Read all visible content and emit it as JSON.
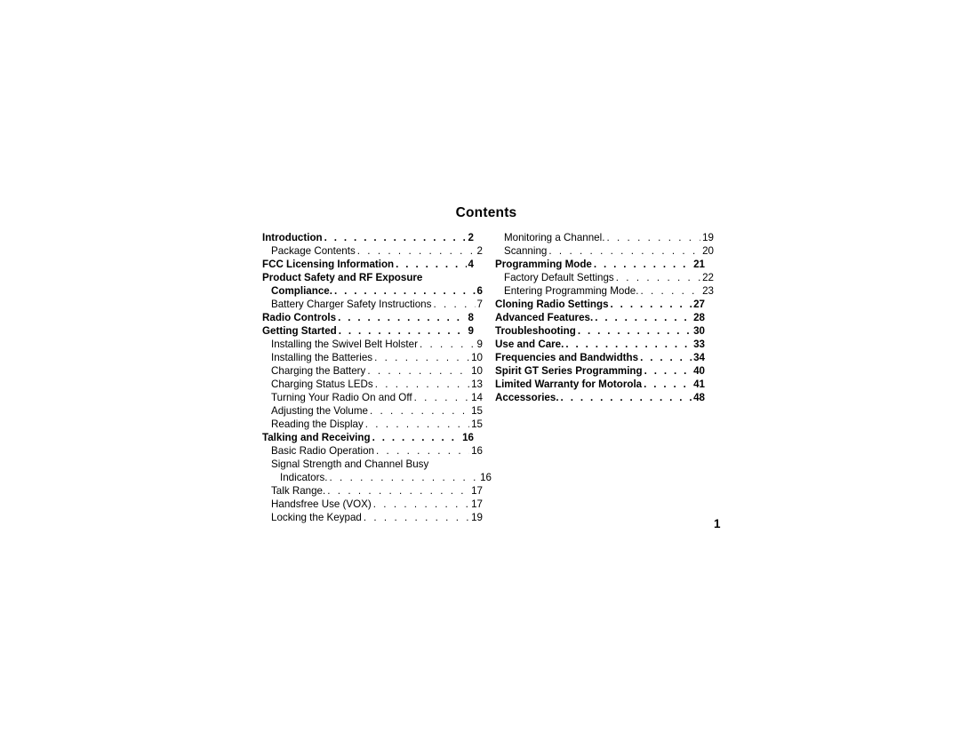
{
  "page": {
    "title": "Contents",
    "folio": "1",
    "background_color": "#ffffff",
    "text_color": "#000000"
  },
  "toc": {
    "leader_dots": ". . . . . . . . . . . . . . . . . . . . . . . . . . . . . . . . . . . . . . . . . . . . . . . . . . . . . . .",
    "left_column": [
      {
        "label": "Introduction",
        "page": "2",
        "level": "chapter",
        "leader": true
      },
      {
        "label": "Package Contents",
        "page": "2",
        "level": "sub",
        "leader": true
      },
      {
        "label": "FCC Licensing Information",
        "page": "4",
        "level": "chapter",
        "leader": true
      },
      {
        "label": "Product Safety and RF Exposure",
        "page": "",
        "level": "chapter",
        "leader": false
      },
      {
        "label": "Compliance.",
        "page": "6",
        "level": "chapter-cont",
        "leader": true
      },
      {
        "label": "Battery Charger Safety Instructions",
        "page": "7",
        "level": "sub",
        "leader": true
      },
      {
        "label": "Radio Controls",
        "page": "8",
        "level": "chapter",
        "leader": true
      },
      {
        "label": "Getting Started",
        "page": "9",
        "level": "chapter",
        "leader": true
      },
      {
        "label": "Installing the Swivel Belt Holster",
        "page": "9",
        "level": "sub",
        "leader": true
      },
      {
        "label": "Installing the Batteries",
        "page": "10",
        "level": "sub",
        "leader": true
      },
      {
        "label": "Charging the Battery",
        "page": "10",
        "level": "sub",
        "leader": true
      },
      {
        "label": "Charging Status LEDs",
        "page": "13",
        "level": "sub",
        "leader": true
      },
      {
        "label": "Turning Your Radio On and Off",
        "page": "14",
        "level": "sub",
        "leader": true
      },
      {
        "label": "Adjusting the Volume",
        "page": "15",
        "level": "sub",
        "leader": true
      },
      {
        "label": "Reading the Display",
        "page": "15",
        "level": "sub",
        "leader": true
      },
      {
        "label": "Talking and Receiving",
        "page": "16",
        "level": "chapter",
        "leader": true
      },
      {
        "label": "Basic Radio Operation",
        "page": "16",
        "level": "sub",
        "leader": true
      },
      {
        "label": "Signal Strength and Channel Busy",
        "page": "",
        "level": "sub",
        "leader": false
      },
      {
        "label": "Indicators.",
        "page": "16",
        "level": "sub-cont",
        "leader": true
      },
      {
        "label": "Talk Range.",
        "page": "17",
        "level": "sub",
        "leader": true
      },
      {
        "label": "Handsfree Use (VOX)",
        "page": "17",
        "level": "sub",
        "leader": true
      },
      {
        "label": "Locking the Keypad",
        "page": "19",
        "level": "sub",
        "leader": true
      }
    ],
    "right_column": [
      {
        "label": "Monitoring a Channel.",
        "page": "19",
        "level": "sub",
        "leader": true
      },
      {
        "label": "Scanning",
        "page": "20",
        "level": "sub",
        "leader": true
      },
      {
        "label": "Programming Mode",
        "page": "21",
        "level": "chapter",
        "leader": true
      },
      {
        "label": "Factory Default Settings",
        "page": "22",
        "level": "sub",
        "leader": true
      },
      {
        "label": "Entering Programming Mode.",
        "page": "23",
        "level": "sub",
        "leader": true
      },
      {
        "label": "Cloning Radio Settings",
        "page": "27",
        "level": "chapter",
        "leader": true
      },
      {
        "label": "Advanced Features.",
        "page": "28",
        "level": "chapter",
        "leader": true
      },
      {
        "label": "Troubleshooting",
        "page": "30",
        "level": "chapter",
        "leader": true
      },
      {
        "label": "Use and Care.",
        "page": "33",
        "level": "chapter",
        "leader": true
      },
      {
        "label": "Frequencies and Bandwidths",
        "page": "34",
        "level": "chapter",
        "leader": true
      },
      {
        "label": "Spirit GT Series Programming",
        "page": "40",
        "level": "chapter",
        "leader": true
      },
      {
        "label": "Limited Warranty for Motorola",
        "page": "41",
        "level": "chapter",
        "leader": true
      },
      {
        "label": "Accessories.",
        "page": "48",
        "level": "chapter",
        "leader": true
      }
    ]
  }
}
